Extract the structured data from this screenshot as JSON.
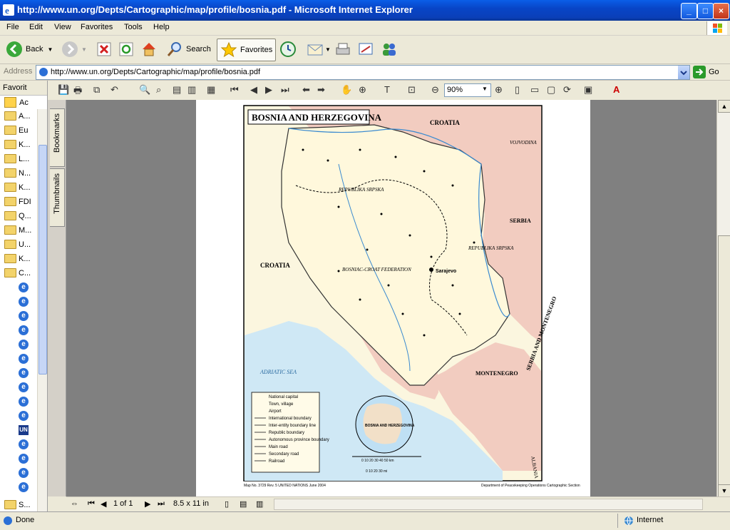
{
  "window": {
    "title": "http://www.un.org/Depts/Cartographic/map/profile/bosnia.pdf - Microsoft Internet Explorer",
    "minimize": "_",
    "maximize": "□",
    "close": "×"
  },
  "menu": [
    "File",
    "Edit",
    "View",
    "Favorites",
    "Tools",
    "Help"
  ],
  "toolbar": {
    "back": "Back",
    "search": "Search",
    "favorites": "Favorites"
  },
  "address": {
    "label": "Address",
    "url": "http://www.un.org/Depts/Cartographic/map/profile/bosnia.pdf",
    "go": "Go"
  },
  "favorites_pane": {
    "title": "Favorit",
    "close": "×",
    "add": "Ac",
    "items": [
      {
        "label": "A...",
        "icon": "folder-icon"
      },
      {
        "label": "Eu",
        "icon": "folder-icon"
      },
      {
        "label": "K...",
        "icon": "folder-icon"
      },
      {
        "label": "L...",
        "icon": "folder-icon"
      },
      {
        "label": "N...",
        "icon": "folder-icon"
      },
      {
        "label": "K...",
        "icon": "folder-icon"
      },
      {
        "label": "FDI",
        "icon": "folder-icon"
      },
      {
        "label": "Q...",
        "icon": "folder-icon"
      },
      {
        "label": "M...",
        "icon": "folder-icon"
      },
      {
        "label": "U...",
        "icon": "folder-icon"
      },
      {
        "label": "K...",
        "icon": "folder-icon"
      },
      {
        "label": "C...",
        "icon": "folder-open-icon"
      }
    ],
    "last_folder": "S...",
    "un_label": "UN"
  },
  "pdf_toolbar": {
    "zoom": "90%"
  },
  "sidetabs": {
    "bookmarks": "Bookmarks",
    "thumbnails": "Thumbnails"
  },
  "map": {
    "title": "BOSNIA AND HERZEGOVINA",
    "countries": [
      "CROATIA",
      "CROATIA",
      "SERBIA",
      "SERBIA AND MONTENEGRO",
      "MONTENEGRO",
      "ALBANIA"
    ],
    "regions": [
      "VOJVODINA",
      "REPUBLIKA SRPSKA",
      "REPUBLIKA SRPSKA",
      "BOSNIAC-CROAT FEDERATION"
    ],
    "sea": "ADRIATIC SEA",
    "capital": "Sarajevo",
    "legend": [
      "National capital",
      "Town, village",
      "Airport",
      "International boundary",
      "Inter-entity boundary line",
      "Republic boundary",
      "Autonomous province boundary",
      "Main road",
      "Secondary road",
      "Railroad"
    ],
    "inset_label": "BOSNIA AND HERZEGOVINA",
    "scale_km": "0  10  20  30  40  50 km",
    "scale_mi": "0  10  20  30 mi",
    "footer_left": "Map No. 3729 Rev. 5   UNITED NATIONS\nJune 2004",
    "footer_right": "Department of Peacekeeping Operations\nCartographic Section"
  },
  "pdf_nav": {
    "page": "1 of 1",
    "size": "8.5 x 11 in"
  },
  "status": {
    "left": "Done",
    "zone": "Internet"
  }
}
